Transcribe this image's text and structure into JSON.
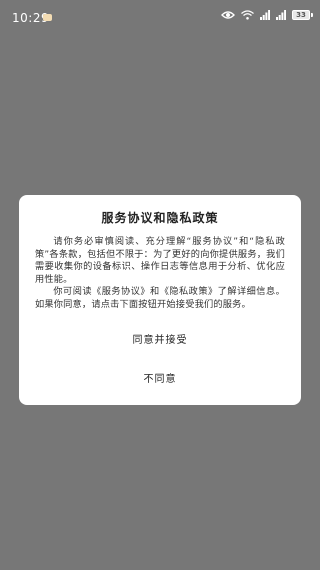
{
  "status_bar": {
    "time": "10:29",
    "battery": "33",
    "icons": [
      "notification-icon",
      "eye-icon",
      "wifi-icon",
      "signal-icon",
      "signal-icon",
      "battery-icon"
    ]
  },
  "dialog": {
    "title": "服务协议和隐私政策",
    "para1": "请你务必审慎阅读、充分理解“服务协议”和“隐私政策”各条款，包括但不限于：为了更好的向你提供服务，我们需要收集你的设备标识、操作日志等信息用于分析、优化应用性能。",
    "para2_prefix": "你可阅读",
    "link_service": "《服务协议》",
    "para2_and": "和",
    "link_privacy": "《隐私政策》",
    "para2_suffix": "了解详细信息。如果你同意，请点击下面按钮开始接受我们的服务。",
    "agree_label": "同意并接受",
    "decline_label": "不同意"
  },
  "colors": {
    "backdrop": "#777777",
    "dialog_bg": "#ffffff",
    "text": "#222222"
  }
}
